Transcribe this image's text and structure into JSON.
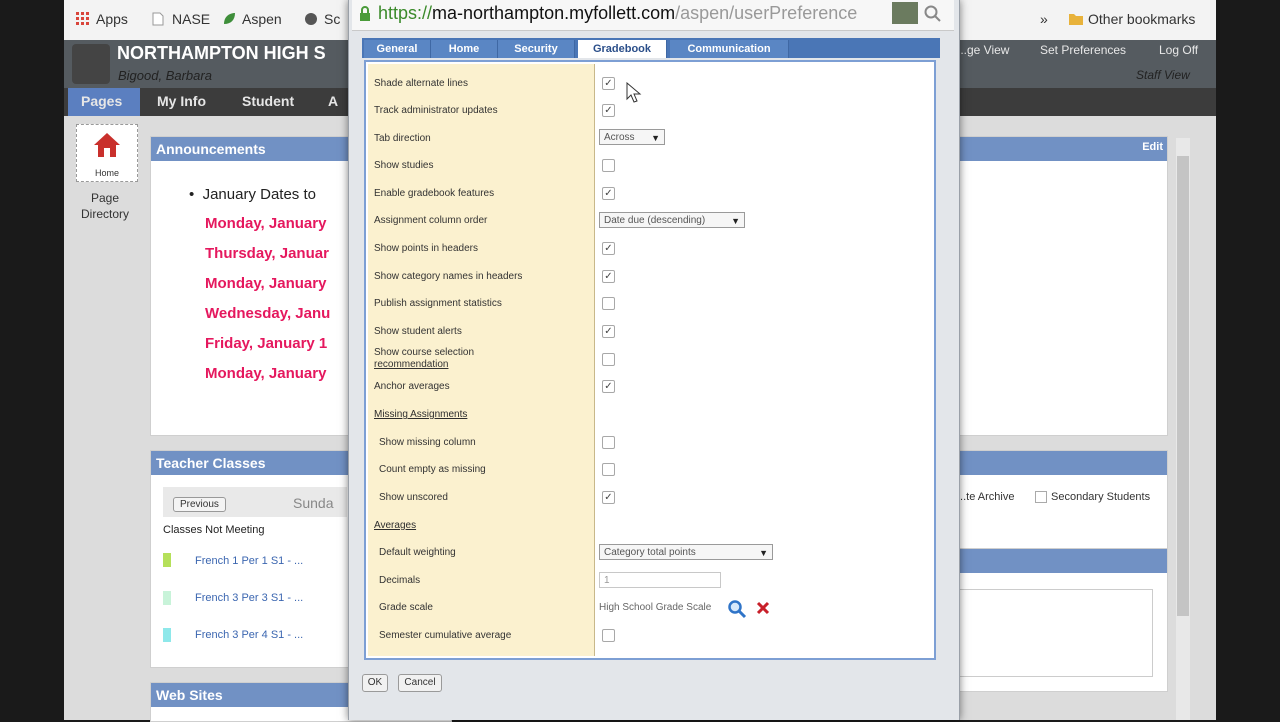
{
  "bookmarks": {
    "items": [
      "Apps",
      "NASE",
      "Aspen",
      "Sc"
    ],
    "overflow": "»",
    "other": "Other bookmarks"
  },
  "browser": {
    "url_secure": "https://",
    "url_host": "ma-northampton.myfollett.com",
    "url_path": "/aspen/userPreference"
  },
  "app": {
    "school": "NORTHAMPTON HIGH S",
    "user": "Bigood, Barbara",
    "top_links": [
      "...ge View",
      "Set Preferences",
      "Log Off"
    ],
    "view": "Staff View",
    "nav": [
      "Pages",
      "My Info",
      "Student",
      "A"
    ],
    "left_nav": {
      "home": "Home",
      "page": "Page",
      "directory": "Directory"
    }
  },
  "announcements": {
    "title": "Announcements",
    "edit": "Edit",
    "lead": "January Dates to",
    "dates": [
      "Monday, January",
      "Thursday, Januar",
      "Monday, January",
      "Wednesday, Janu",
      "Friday, January 1",
      "Monday, January"
    ]
  },
  "teacher_classes": {
    "title": "Teacher Classes",
    "previous": "Previous",
    "day": "Sunda",
    "not_meeting": "Classes Not Meeting",
    "classes": [
      "French 1 Per 1 S1 - ...",
      "French 3 Per 3 S1 - ...",
      "French 3 Per 4 S1 - ..."
    ],
    "archive_label": "...te Archive",
    "secondary": "Secondary Students"
  },
  "web_sites": {
    "title": "Web Sites"
  },
  "dialog": {
    "tabs": [
      "General",
      "Home",
      "Security",
      "Gradebook",
      "Communication"
    ],
    "active_tab": "Gradebook",
    "rows": [
      {
        "label": "Shade alternate lines",
        "checked": true
      },
      {
        "label": "Track administrator updates",
        "checked": true
      },
      {
        "label": "Tab direction",
        "select": "Across"
      },
      {
        "label": "Show studies",
        "checked": false
      },
      {
        "label": "Enable gradebook features",
        "checked": true
      },
      {
        "label": "Assignment column order",
        "select": "Date due (descending)"
      },
      {
        "label": "Show points in headers",
        "checked": true
      },
      {
        "label": "Show category names in headers",
        "checked": true
      },
      {
        "label": "Publish assignment statistics",
        "checked": false
      },
      {
        "label": "Show student alerts",
        "checked": true
      },
      {
        "label": "Show course selection",
        "label2": "recommendation",
        "checked": false
      },
      {
        "label": "Anchor averages",
        "checked": true
      },
      {
        "label": "Missing Assignments",
        "header": true
      },
      {
        "label": "Show missing column",
        "checked": false
      },
      {
        "label": "Count empty as missing",
        "checked": false
      },
      {
        "label": "Show unscored",
        "checked": true
      },
      {
        "label": "Averages",
        "header": true
      },
      {
        "label": "Default weighting",
        "select": "Category total points"
      },
      {
        "label": "Decimals",
        "input": "1"
      },
      {
        "label": "Grade scale",
        "text": "High School Grade Scale"
      },
      {
        "label": "Semester cumulative average",
        "checked": false
      }
    ],
    "ok": "OK",
    "cancel": "Cancel"
  },
  "colors": {
    "accent": "#7191c4",
    "tab_bar": "#4a76b6",
    "label_bg": "#fbf1cf",
    "announcement_red": "#e5185e"
  },
  "icons": [
    "apps-grid-icon",
    "page-icon",
    "leaf-icon",
    "folder-icon",
    "lock-icon",
    "search-icon",
    "home-icon",
    "magnifier-icon",
    "delete-icon",
    "cursor-icon"
  ]
}
